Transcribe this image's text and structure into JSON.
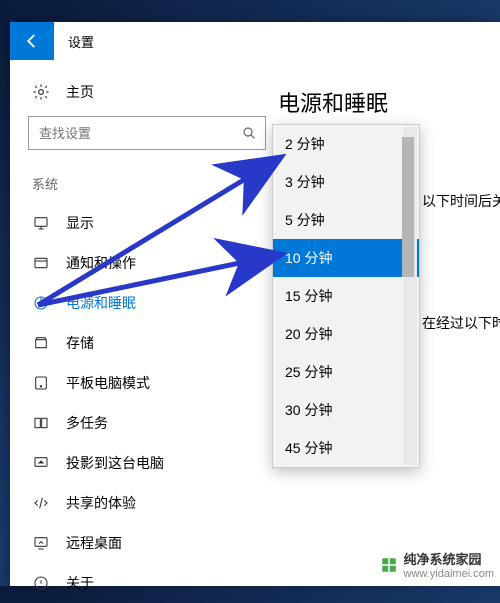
{
  "window": {
    "title": "设置"
  },
  "home": {
    "label": "主页"
  },
  "search": {
    "placeholder": "查找设置"
  },
  "section": {
    "label": "系统"
  },
  "nav": {
    "items": [
      {
        "label": "显示"
      },
      {
        "label": "通知和操作"
      },
      {
        "label": "电源和睡眠"
      },
      {
        "label": "存储"
      },
      {
        "label": "平板电脑模式"
      },
      {
        "label": "多任务"
      },
      {
        "label": "投影到这台电脑"
      },
      {
        "label": "共享的体验"
      },
      {
        "label": "远程桌面"
      },
      {
        "label": "关于"
      }
    ],
    "active_index": 2
  },
  "main": {
    "title": "电源和睡眠",
    "side_text_1": "以下时间后关闭",
    "side_text_2": "在经过以下时间后"
  },
  "dropdown": {
    "options": [
      "2 分钟",
      "3 分钟",
      "5 分钟",
      "10 分钟",
      "15 分钟",
      "20 分钟",
      "25 分钟",
      "30 分钟",
      "45 分钟"
    ],
    "selected_index": 3
  },
  "watermark": {
    "brand": "纯净系统家园",
    "url": "www.yidaimei.com"
  }
}
